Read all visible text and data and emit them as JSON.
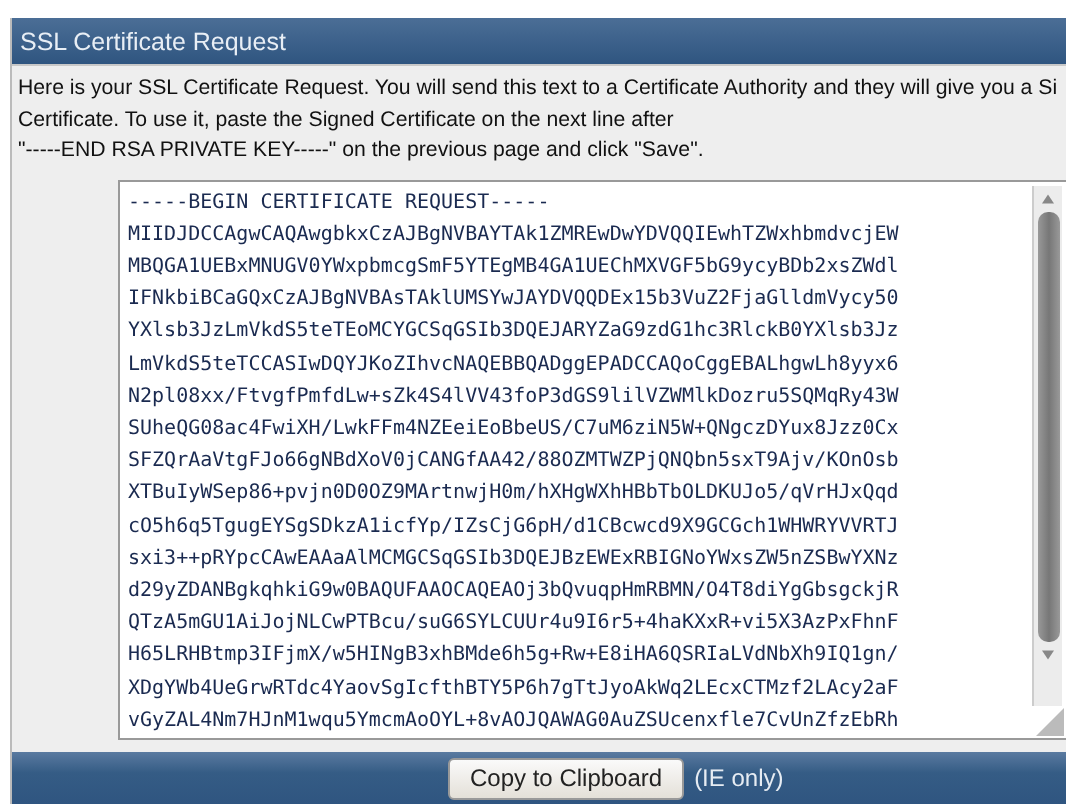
{
  "panel": {
    "title": "SSL Certificate Request",
    "instructions": [
      "Here is your SSL Certificate Request. You will send this text to a Certificate Authority and they will give you a Si",
      "Certificate. To use it, paste the Signed Certificate on the next line after",
      "\"-----END RSA PRIVATE KEY-----\" on the previous page and click \"Save\"."
    ],
    "certificate_lines": [
      "-----BEGIN CERTIFICATE REQUEST-----",
      "MIIDJDCCAgwCAQAwgbkxCzAJBgNVBAYTAk1ZMREwDwYDVQQIEwhTZWxhbmdvcjEW",
      "MBQGA1UEBxMNUGV0YWxpbmcgSmF5YTEgMB4GA1UEChMXVGF5bG9ycyBDb2xsZWdl",
      "IFNkbiBCaGQxCzAJBgNVBAsTAklUMSYwJAYDVQQDEx15b3VuZ2FjaGlldmVycy50",
      "YXlsb3JzLmVkdS5teTEoMCYGCSqGSIb3DQEJARYZaG9zdG1hc3RlckB0YXlsb3Jz",
      "LmVkdS5teTCCASIwDQYJKoZIhvcNAQEBBQADggEPADCCAQoCggEBALhgwLh8yyx6",
      "N2pl08xx/FtvgfPmfdLw+sZk4S4lVV43foP3dGS9lilVZWMlkDozru5SQMqRy43W",
      "SUheQG08ac4FwiXH/LwkFFm4NZEeiEoBbeUS/C7uM6ziN5W+QNgczDYux8Jzz0Cx",
      "SFZQrAaVtgFJo66gNBdXoV0jCANGfAA42/88OZMTWZPjQNQbn5sxT9Ajv/KOnOsb",
      "XTBuIyWSep86+pvjn0D0OZ9MArtnwjH0m/hXHgWXhHBbTbOLDKUJo5/qVrHJxQqd",
      "cO5h6q5TgugEYSgSDkzA1icfYp/IZsCjG6pH/d1CBcwcd9X9GCGch1WHWRYVVRTJ",
      "sxi3++pRYpcCAwEAAaAlMCMGCSqGSIb3DQEJBzEWExRBIGNoYWxsZW5nZSBwYXNz",
      "d29yZDANBgkqhkiG9w0BAQUFAAOCAQEAOj3bQvuqpHmRBMN/O4T8diYgGbsgckjR",
      "QTzA5mGU1AiJojNLCwPTBcu/suG6SYLCUUr4u9I6r5+4haKXxR+vi5X3AzPxFhnF",
      "H65LRHBtmp3IFjmX/w5HINgB3xhBMde6h5g+Rw+E8iHA6QSRIaLVdNbXh9IQ1gn/",
      "XDgYWb4UeGrwRTdc4YaovSgIcfthBTY5P6h7gTtJyoAkWq2LEcxCTMzf2LAcy2aF",
      "vGyZAL4Nm7HJnM1wqu5YmcmAoOYL+8vAOJQAWAG0AuZSUcenxfle7CvUnZfzEbRh"
    ],
    "copy_button": "Copy to Clipboard",
    "copy_note": "(IE only)"
  }
}
